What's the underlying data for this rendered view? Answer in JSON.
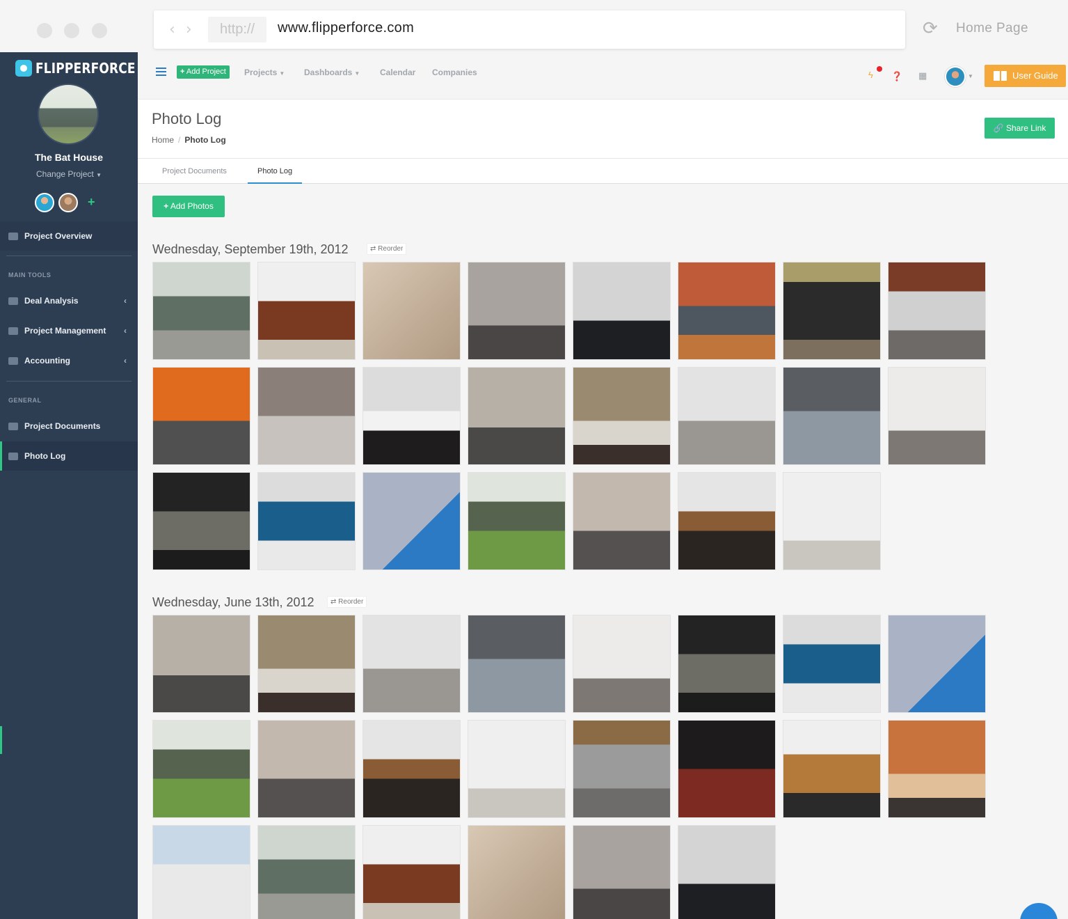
{
  "browser": {
    "http_label": "http://",
    "url": "www.flipperforce.com",
    "home_label": "Home Page",
    "back_icon": "chevron-left-icon",
    "forward_icon": "chevron-right-icon",
    "reload_icon": "reload-icon"
  },
  "sidebar": {
    "brand": "FLIPPERFORCE",
    "project_name": "The Bat House",
    "change_project": "Change Project",
    "add_member": "+",
    "sections": {
      "main": "MAIN TOOLS",
      "general": "GENERAL"
    },
    "items": [
      {
        "label": "Project Overview",
        "icon": "home-icon"
      },
      {
        "label": "Deal Analysis",
        "icon": "calculator-icon"
      },
      {
        "label": "Project Management",
        "icon": "list-icon"
      },
      {
        "label": "Accounting",
        "icon": "money-icon"
      },
      {
        "label": "Project Documents",
        "icon": "folder-icon"
      },
      {
        "label": "Photo Log",
        "icon": "photo-icon"
      }
    ]
  },
  "topnav": {
    "add_project": "Add Project",
    "links": [
      "Projects",
      "Dashboards",
      "Calendar",
      "Companies"
    ],
    "user_guide": "User Guide",
    "accent": "#2fb57a",
    "guide_color": "#f6a93b"
  },
  "page": {
    "title": "Photo Log",
    "breadcrumb": [
      "Home",
      "Photo Log"
    ],
    "share_link": "Share Link",
    "tabs": [
      "Project Documents",
      "Photo Log"
    ],
    "add_photos": "Add Photos",
    "reorder_label": "Reorder",
    "groups": [
      {
        "date": "Wednesday, September 19th, 2012",
        "photo_count": 23
      },
      {
        "date": "Wednesday, June 13th, 2012",
        "photo_count": 22
      }
    ]
  }
}
